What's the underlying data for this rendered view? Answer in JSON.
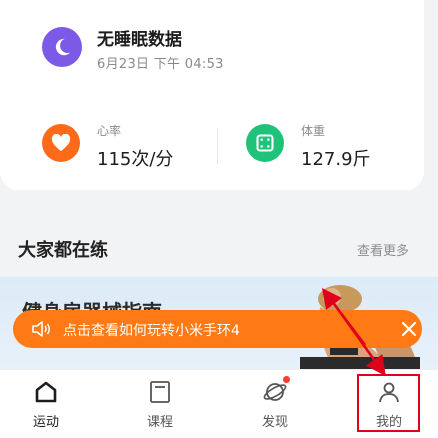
{
  "sleep": {
    "title": "无睡眠数据",
    "time": "6月23日  下午 04:53"
  },
  "heart_rate": {
    "label": "心率",
    "value": "115次/分"
  },
  "weight": {
    "label": "体重",
    "value": "127.9斤"
  },
  "section": {
    "title": "大家都在练",
    "more": "查看更多"
  },
  "banner": {
    "title": "健身房器械指南"
  },
  "toast": {
    "text": "点击查看如何玩转小米手环4"
  },
  "tabs": [
    {
      "label": "运动",
      "icon": "home-icon"
    },
    {
      "label": "课程",
      "icon": "course-icon"
    },
    {
      "label": "发现",
      "icon": "discover-planet-icon"
    },
    {
      "label": "我的",
      "icon": "profile-icon"
    }
  ],
  "colors": {
    "sleep": "#7c59e6",
    "heart": "#ff6a1a",
    "weight": "#20c27a",
    "toast": "#ff7a14",
    "highlight": "#e0001a"
  }
}
